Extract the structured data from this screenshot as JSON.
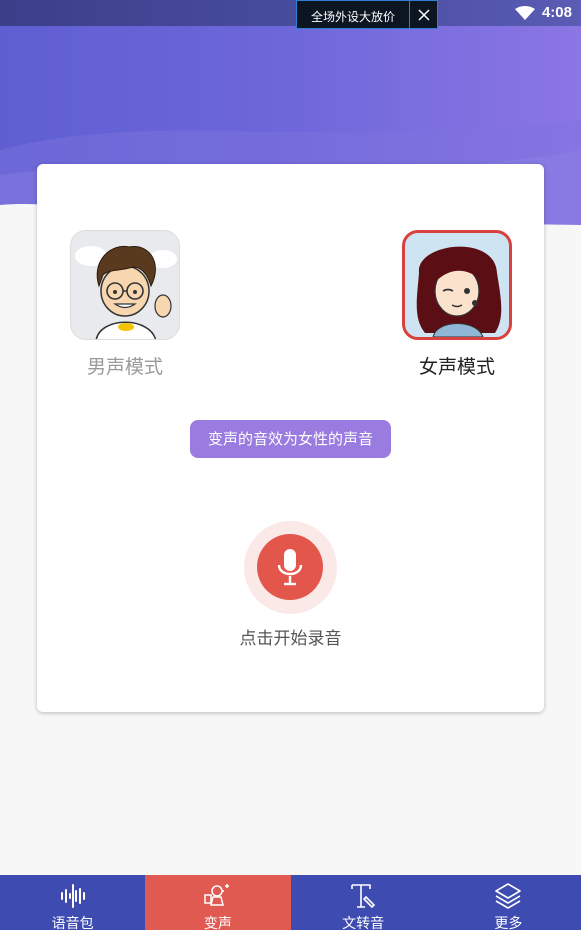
{
  "status_bar": {
    "time": "4:08",
    "wifi_icon": "wifi-icon"
  },
  "ad": {
    "text": "全场外设大放价",
    "close_icon": "close-icon"
  },
  "modes": {
    "male": {
      "label": "男声模式",
      "selected": false
    },
    "female": {
      "label": "女声模式",
      "selected": true
    }
  },
  "hint": "变声的音效为女性的声音",
  "record": {
    "label": "点击开始录音",
    "icon": "microphone-icon"
  },
  "nav": {
    "items": [
      {
        "label": "语音包",
        "icon": "voice-pack-icon",
        "active": false
      },
      {
        "label": "变声",
        "icon": "voice-change-icon",
        "active": true
      },
      {
        "label": "文转音",
        "icon": "text-to-speech-icon",
        "active": false
      },
      {
        "label": "更多",
        "icon": "layers-icon",
        "active": false
      }
    ]
  },
  "colors": {
    "accent": "#6c66d9",
    "nav_bg": "#3e4cb2",
    "nav_active": "#e05a52",
    "hint_bg": "#9a7be0",
    "record": "#e2564c"
  }
}
